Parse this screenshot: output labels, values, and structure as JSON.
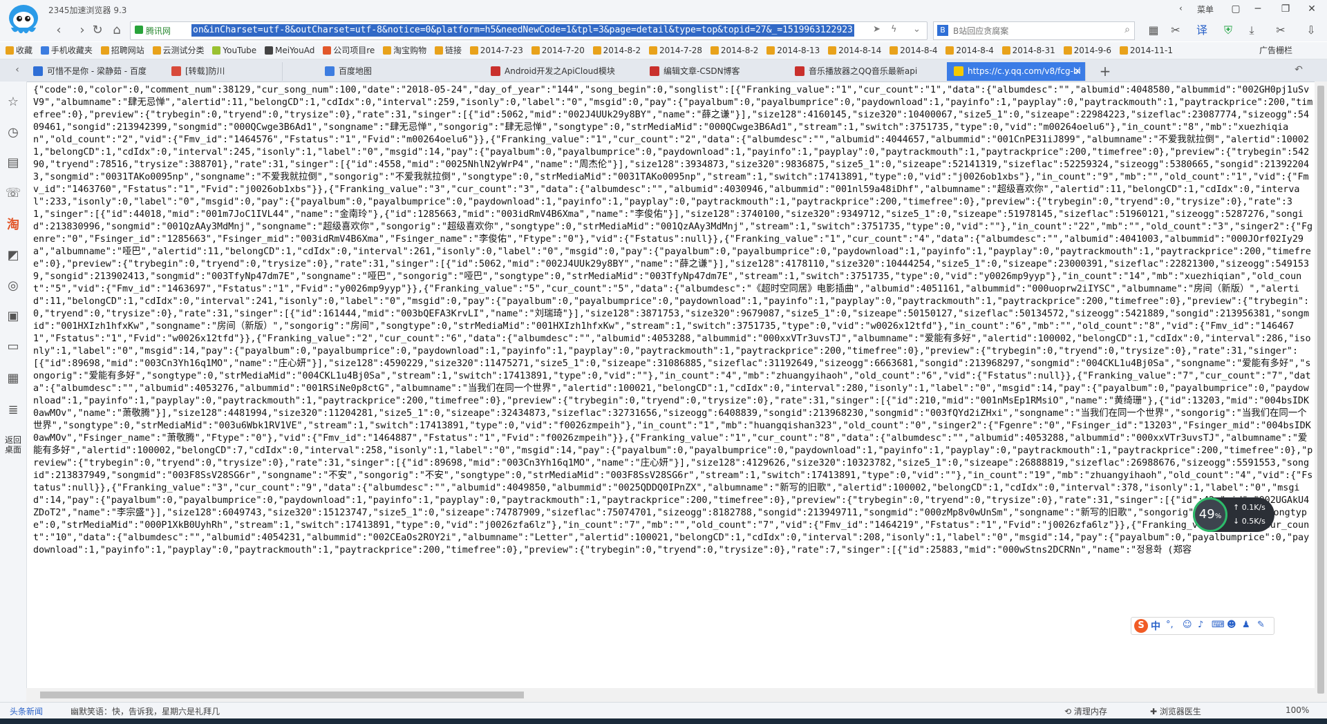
{
  "window": {
    "app_title": "2345加速浏览器 9.3",
    "menu_label": "菜单"
  },
  "address_bar": {
    "secure_label": "腾讯网",
    "url": "on&inCharset=utf-8&outCharset=utf-8&notice=0&platform=h5&needNewCode=1&tpl=3&page=detail&type=top&topid=27&_=1519963122923",
    "search_placeholder": "B站回应贪腐案",
    "search_engine_label": "B"
  },
  "bookmarks": [
    {
      "label": "收藏",
      "color": "#e8a21b"
    },
    {
      "label": "手机收藏夹",
      "color": "#3d7de0"
    },
    {
      "label": "招聘网站",
      "color": "#e8a21b"
    },
    {
      "label": "云测试分类",
      "color": "#e8a21b"
    },
    {
      "label": "YouTube",
      "color": "#9ac131"
    },
    {
      "label": "MeiYouAd",
      "color": "#444444"
    },
    {
      "label": "公司项目re",
      "color": "#e2582b"
    },
    {
      "label": "淘宝购物",
      "color": "#e8a21b"
    },
    {
      "label": "链接",
      "color": "#e8a21b"
    },
    {
      "label": "2014-7-23",
      "color": "#e8a21b"
    },
    {
      "label": "2014-7-20",
      "color": "#e8a21b"
    },
    {
      "label": "2014-8-2",
      "color": "#e8a21b"
    },
    {
      "label": "2014-7-28",
      "color": "#e8a21b"
    },
    {
      "label": "2014-8-2",
      "color": "#e8a21b"
    },
    {
      "label": "2014-8-13",
      "color": "#e8a21b"
    },
    {
      "label": "2014-8-14",
      "color": "#e8a21b"
    },
    {
      "label": "2014-8-4",
      "color": "#e8a21b"
    },
    {
      "label": "2014-8-4",
      "color": "#e8a21b"
    },
    {
      "label": "2014-8-31",
      "color": "#e8a21b"
    },
    {
      "label": "2014-9-6",
      "color": "#e8a21b"
    },
    {
      "label": "2014-11-1",
      "color": "#e8a21b"
    }
  ],
  "bookmark_ad": "广告栅栏",
  "tabs": [
    {
      "label": "可惜不是你 - 梁静茹 - 百度",
      "color": "#2f6fd6",
      "active": false
    },
    {
      "label": "[转载]防川",
      "color": "#d84a3a",
      "active": false
    },
    {
      "label": "百度地图",
      "color": "#3d7de0",
      "active": false
    },
    {
      "label": "Android开发之ApiCloud模块",
      "color": "#c9302c",
      "active": false
    },
    {
      "label": "编辑文章-CSDN博客",
      "color": "#c9302c",
      "active": false
    },
    {
      "label": "音乐播放器之QQ音乐最新api",
      "color": "#c9302c",
      "active": false
    },
    {
      "label": "https://c.y.qq.com/v8/fcg-bi",
      "color": "#f5c900",
      "active": true
    }
  ],
  "sidebar": {
    "desktop_label": "返回桌面"
  },
  "content": {
    "json_text": "{\"code\":0,\"color\":0,\"comment_num\":38129,\"cur_song_num\":100,\"date\":\"2018-05-24\",\"day_of_year\":\"144\",\"song_begin\":0,\"songlist\":[{\"Franking_value\":\"1\",\"cur_count\":\"1\",\"data\":{\"albumdesc\":\"\",\"albumid\":4048580,\"albummid\":\"002GH0pj1uSvV9\",\"albumname\":\"肆无忌惮\",\"alertid\":11,\"belongCD\":1,\"cdIdx\":0,\"interval\":259,\"isonly\":0,\"label\":\"0\",\"msgid\":0,\"pay\":{\"payalbum\":0,\"payalbumprice\":0,\"paydownload\":1,\"payinfo\":1,\"payplay\":0,\"paytrackmouth\":1,\"paytrackprice\":200,\"timefree\":0},\"preview\":{\"trybegin\":0,\"tryend\":0,\"trysize\":0},\"rate\":31,\"singer\":[{\"id\":5062,\"mid\":\"002J4UUk29y8BY\",\"name\":\"薛之谦\"}],\"size128\":4160145,\"size320\":10400067,\"size5_1\":0,\"sizeape\":22984223,\"sizeflac\":23087774,\"sizeogg\":5409461,\"songid\":213942399,\"songmid\":\"000QCwge3B6Ad1\",\"songname\":\"肆无忌惮\",\"songorig\":\"肆无忌惮\",\"songtype\":0,\"strMediaMid\":\"000QCwge3B6Ad1\",\"stream\":1,\"switch\":3751735,\"type\":0,\"vid\":\"m00264oelu6\"},\"in_count\":\"8\",\"mb\":\"xuezhiqian\",\"old_count\":\"2\",\"vid\":{\"Fmv_id\":\"1464576\",\"Fstatus\":\"1\",\"Fvid\":\"m00264oelu6\"}},{\"Franking_value\":\"1\",\"cur_count\":\"2\",\"data\":{\"albumdesc\":\"\",\"albumid\":4044657,\"albummid\":\"001CnPE31iJ899\",\"albumname\":\"不爱我就拉倒\",\"alertid\":100021,\"belongCD\":1,\"cdIdx\":0,\"interval\":245,\"isonly\":1,\"label\":\"0\",\"msgid\":14,\"pay\":{\"payalbum\":0,\"payalbumprice\":0,\"paydownload\":1,\"payinfo\":1,\"payplay\":0,\"paytrackmouth\":1,\"paytrackprice\":200,\"timefree\":0},\"preview\":{\"trybegin\":54290,\"tryend\":78516,\"trysize\":388701},\"rate\":31,\"singer\":[{\"id\":4558,\"mid\":\"0025NhlN2yWrP4\",\"name\":\"周杰伦\"}],\"size128\":3934873,\"size320\":9836875,\"size5_1\":0,\"sizeape\":52141319,\"sizeflac\":52259324,\"sizeogg\":5380665,\"songid\":213922043,\"songmid\":\"0031TAKo0095np\",\"songname\":\"不爱我就拉倒\",\"songorig\":\"不爱我就拉倒\",\"songtype\":0,\"strMediaMid\":\"0031TAKo0095np\",\"stream\":1,\"switch\":17413891,\"type\":0,\"vid\":\"j0026ob1xbs\"},\"in_count\":\"9\",\"mb\":\"\",\"old_count\":\"1\",\"vid\":{\"Fmv_id\":\"1463760\",\"Fstatus\":\"1\",\"Fvid\":\"j0026ob1xbs\"}},{\"Franking_value\":\"3\",\"cur_count\":\"3\",\"data\":{\"albumdesc\":\"\",\"albumid\":4030946,\"albummid\":\"001nl59a48iDhf\",\"albumname\":\"超级喜欢你\",\"alertid\":11,\"belongCD\":1,\"cdIdx\":0,\"interval\":233,\"isonly\":0,\"label\":\"0\",\"msgid\":0,\"pay\":{\"payalbum\":0,\"payalbumprice\":0,\"paydownload\":1,\"payinfo\":1,\"payplay\":0,\"paytrackmouth\":1,\"paytrackprice\":200,\"timefree\":0},\"preview\":{\"trybegin\":0,\"tryend\":0,\"trysize\":0},\"rate\":31,\"singer\":[{\"id\":44018,\"mid\":\"001m7JoC1IVL44\",\"name\":\"金南玲\"},{\"id\":1285663,\"mid\":\"003idRmV4B6Xma\",\"name\":\"李俊佑\"}],\"size128\":3740100,\"size320\":9349712,\"size5_1\":0,\"sizeape\":51978145,\"sizeflac\":51960121,\"sizeogg\":5287276,\"songid\":213830996,\"songmid\":\"001QzAAy3MdMnj\",\"songname\":\"超级喜欢你\",\"songorig\":\"超级喜欢你\",\"songtype\":0,\"strMediaMid\":\"001QzAAy3MdMnj\",\"stream\":1,\"switch\":3751735,\"type\":0,\"vid\":\"\"},\"in_count\":\"22\",\"mb\":\"\",\"old_count\":\"3\",\"singer2\":{\"Fgenre\":\"0\",\"Fsinger_id\":\"1285663\",\"Fsinger_mid\":\"003idRmV4B6Xma\",\"Fsinger_name\":\"李俊佑\",\"Ftype\":\"0\"},\"vid\":{\"Fstatus\":null}},{\"Franking_value\":\"1\",\"cur_count\":\"4\",\"data\":{\"albumdesc\":\"\",\"albumid\":4041003,\"albummid\":\"000JOrf02Iy29a\",\"albumname\":\"哑巴\",\"alertid\":11,\"belongCD\":1,\"cdIdx\":0,\"interval\":261,\"isonly\":0,\"label\":\"0\",\"msgid\":0,\"pay\":{\"payalbum\":0,\"payalbumprice\":0,\"paydownload\":1,\"payinfo\":1,\"payplay\":0,\"paytrackmouth\":1,\"paytrackprice\":200,\"timefree\":0},\"preview\":{\"trybegin\":0,\"tryend\":0,\"trysize\":0},\"rate\":31,\"singer\":[{\"id\":5062,\"mid\":\"002J4UUk29y8BY\",\"name\":\"薛之谦\"}],\"size128\":4178110,\"size320\":10444254,\"size5_1\":0,\"sizeape\":23000391,\"sizeflac\":22821300,\"sizeogg\":5491539,\"songid\":213902413,\"songmid\":\"003TfyNp47dm7E\",\"songname\":\"哑巴\",\"songorig\":\"哑巴\",\"songtype\":0,\"strMediaMid\":\"003TfyNp47dm7E\",\"stream\":1,\"switch\":3751735,\"type\":0,\"vid\":\"y0026mp9yyp\"},\"in_count\":\"14\",\"mb\":\"xuezhiqian\",\"old_count\":\"5\",\"vid\":{\"Fmv_id\":\"1463697\",\"Fstatus\":\"1\",\"Fvid\":\"y0026mp9yyp\"}},{\"Franking_value\":\"5\",\"cur_count\":\"5\",\"data\":{\"albumdesc\":\"《超时空同居》电影插曲\",\"albumid\":4051161,\"albummid\":\"000uoprw2iIYSC\",\"albumname\":\"房间（新版）\",\"alertid\":11,\"belongCD\":1,\"cdIdx\":0,\"interval\":241,\"isonly\":0,\"label\":\"0\",\"msgid\":0,\"pay\":{\"payalbum\":0,\"payalbumprice\":0,\"paydownload\":1,\"payinfo\":1,\"payplay\":0,\"paytrackmouth\":1,\"paytrackprice\":200,\"timefree\":0},\"preview\":{\"trybegin\":0,\"tryend\":0,\"trysize\":0},\"rate\":31,\"singer\":[{\"id\":161444,\"mid\":\"003bQEFA3KrvLI\",\"name\":\"刘瑞琦\"}],\"size128\":3871753,\"size320\":9679087,\"size5_1\":0,\"sizeape\":50150127,\"sizeflac\":50134572,\"sizeogg\":5421889,\"songid\":213956381,\"songmid\":\"001HXIzh1hfxKw\",\"songname\":\"房间（新版）\",\"songorig\":\"房间\",\"songtype\":0,\"strMediaMid\":\"001HXIzh1hfxKw\",\"stream\":1,\"switch\":3751735,\"type\":0,\"vid\":\"w0026x12tfd\"},\"in_count\":\"6\",\"mb\":\"\",\"old_count\":\"8\",\"vid\":{\"Fmv_id\":\"1464671\",\"Fstatus\":\"1\",\"Fvid\":\"w0026x12tfd\"}},{\"Franking_value\":\"2\",\"cur_count\":\"6\",\"data\":{\"albumdesc\":\"\",\"albumid\":4053288,\"albummid\":\"000xxVTr3uvsTJ\",\"albumname\":\"爱能有多好\",\"alertid\":100002,\"belongCD\":1,\"cdIdx\":0,\"interval\":286,\"isonly\":1,\"label\":\"0\",\"msgid\":14,\"pay\":{\"payalbum\":0,\"payalbumprice\":0,\"paydownload\":1,\"payinfo\":1,\"payplay\":0,\"paytrackmouth\":1,\"paytrackprice\":200,\"timefree\":0},\"preview\":{\"trybegin\":0,\"tryend\":0,\"trysize\":0},\"rate\":31,\"singer\":[{\"id\":89698,\"mid\":\"003Cn3Yh16q1MO\",\"name\":\"庄心妍\"}],\"size128\":4590229,\"size320\":11475271,\"size5_1\":0,\"sizeape\":31086885,\"sizeflac\":31192649,\"sizeogg\":6663681,\"songid\":213968297,\"songmid\":\"004CKL1u4Bj0Sa\",\"songname\":\"爱能有多好\",\"songorig\":\"爱能有多好\",\"songtype\":0,\"strMediaMid\":\"004CKL1u4Bj0Sa\",\"stream\":1,\"switch\":17413891,\"type\":0,\"vid\":\"\"},\"in_count\":\"4\",\"mb\":\"zhuangyihaoh\",\"old_count\":\"6\",\"vid\":{\"Fstatus\":null}},{\"Franking_value\":\"7\",\"cur_count\":\"7\",\"data\":{\"albumdesc\":\"\",\"albumid\":4053276,\"albummid\":\"001RSiNe0p8ctG\",\"albumname\":\"当我们在同一个世界\",\"alertid\":100021,\"belongCD\":1,\"cdIdx\":0,\"interval\":280,\"isonly\":1,\"label\":\"0\",\"msgid\":14,\"pay\":{\"payalbum\":0,\"payalbumprice\":0,\"paydownload\":1,\"payinfo\":1,\"payplay\":0,\"paytrackmouth\":1,\"paytrackprice\":200,\"timefree\":0},\"preview\":{\"trybegin\":0,\"tryend\":0,\"trysize\":0},\"rate\":31,\"singer\":[{\"id\":210,\"mid\":\"001nMsEp1RMsiO\",\"name\":\"黄绮珊\"},{\"id\":13203,\"mid\":\"004bsIDK0awMOv\",\"name\":\"萧敬腾\"}],\"size128\":4481994,\"size320\":11204281,\"size5_1\":0,\"sizeape\":32434873,\"sizeflac\":32731656,\"sizeogg\":6408839,\"songid\":213968230,\"songmid\":\"003fQYd2iZHxi\",\"songname\":\"当我们在同一个世界\",\"songorig\":\"当我们在同一个世界\",\"songtype\":0,\"strMediaMid\":\"003u6Wbk1RV1VE\",\"stream\":1,\"switch\":17413891,\"type\":0,\"vid\":\"f0026zmpeih\"},\"in_count\":\"1\",\"mb\":\"huangqishan323\",\"old_count\":\"0\",\"singer2\":{\"Fgenre\":\"0\",\"Fsinger_id\":\"13203\",\"Fsinger_mid\":\"004bsIDK0awMOv\",\"Fsinger_name\":\"萧敬腾\",\"Ftype\":\"0\"},\"vid\":{\"Fmv_id\":\"1464887\",\"Fstatus\":\"1\",\"Fvid\":\"f0026zmpeih\"}},{\"Franking_value\":\"1\",\"cur_count\":\"8\",\"data\":{\"albumdesc\":\"\",\"albumid\":4053288,\"albummid\":\"000xxVTr3uvsTJ\",\"albumname\":\"爱能有多好\",\"alertid\":100002,\"belongCD\":7,\"cdIdx\":0,\"interval\":258,\"isonly\":1,\"label\":\"0\",\"msgid\":14,\"pay\":{\"payalbum\":0,\"payalbumprice\":0,\"paydownload\":1,\"payinfo\":1,\"payplay\":0,\"paytrackmouth\":1,\"paytrackprice\":200,\"timefree\":0},\"preview\":{\"trybegin\":0,\"tryend\":0,\"trysize\":0},\"rate\":31,\"singer\":[{\"id\":89698,\"mid\":\"003Cn3Yh16q1MO\",\"name\":\"庄心妍\"}],\"size128\":4129626,\"size320\":10323782,\"size5_1\":0,\"sizeape\":26888819,\"sizeflac\":26988676,\"sizeogg\":5591553,\"songid\":213837949,\"songmid\":\"003F8SsV28SG6r\",\"songname\":\"不安\",\"songorig\":\"不安\",\"songtype\":0,\"strMediaMid\":\"003F8SsV28SG6r\",\"stream\":1,\"switch\":17413891,\"type\":0,\"vid\":\"\"},\"in_count\":\"19\",\"mb\":\"zhuangyihaoh\",\"old_count\":\"4\",\"vid\":{\"Fstatus\":null}},{\"Franking_value\":\"3\",\"cur_count\":\"9\",\"data\":{\"albumdesc\":\"\",\"albumid\":4049850,\"albummid\":\"0025QDDQ0IPnZX\",\"albumname\":\"新写的旧歌\",\"alertid\":100002,\"belongCD\":1,\"cdIdx\":0,\"interval\":378,\"isonly\":1,\"label\":\"0\",\"msgid\":14,\"pay\":{\"payalbum\":0,\"payalbumprice\":0,\"paydownload\":1,\"payinfo\":1,\"payplay\":0,\"paytrackmouth\":1,\"paytrackprice\":200,\"timefree\":0},\"preview\":{\"trybegin\":0,\"tryend\":0,\"trysize\":0},\"rate\":31,\"singer\":[{\"id\":42,\"mid\":\"002UGAkU4ZDoT2\",\"name\":\"李宗盛\"}],\"size128\":6049743,\"size320\":15123747,\"size5_1\":0,\"sizeape\":74787909,\"sizeflac\":75074701,\"sizeogg\":8182788,\"songid\":213949711,\"songmid\":\"000zMp8v0wUnSm\",\"songname\":\"新写的旧歌\",\"songorig\":\"新写的旧歌\",\"songtype\":0,\"strMediaMid\":\"000P1XkB0UyhRh\",\"stream\":1,\"switch\":17413891,\"type\":0,\"vid\":\"j0026zfa6lz\"},\"in_count\":\"7\",\"mb\":\"\",\"old_count\":\"7\",\"vid\":{\"Fmv_id\":\"1464219\",\"Fstatus\":\"1\",\"Fvid\":\"j0026zfa6lz\"}},{\"Franking_value\":\"10\",\"cur_count\":\"10\",\"data\":{\"albumdesc\":\"\",\"albumid\":4054231,\"albummid\":\"002CEaOs2ROY2i\",\"albumname\":\"Letter\",\"alertid\":100021,\"belongCD\":1,\"cdIdx\":0,\"interval\":208,\"isonly\":1,\"label\":\"0\",\"msgid\":14,\"pay\":{\"payalbum\":0,\"payalbumprice\":0,\"paydownload\":1,\"payinfo\":1,\"payplay\":0,\"paytrackmouth\":1,\"paytrackprice\":200,\"timefree\":0},\"preview\":{\"trybegin\":0,\"tryend\":0,\"trysize\":0},\"rate\":7,\"singer\":[{\"id\":25883,\"mid\":\"000wStns2DCRNn\",\"name\":\"정용화 (郑容"
  },
  "widgets": {
    "perf_percent": "49",
    "perf_unit": "%",
    "upload_speed": "0.1K/s",
    "download_speed": "0.5K/s",
    "ime_mode": "中"
  },
  "statusbar": {
    "news_label": "头条新闻",
    "news_text": "幽默笑语：快，告诉我，星期六是礼拜几",
    "memory_label": "清理内存",
    "doctor_label": "浏览器医生",
    "zoom": "100%"
  }
}
